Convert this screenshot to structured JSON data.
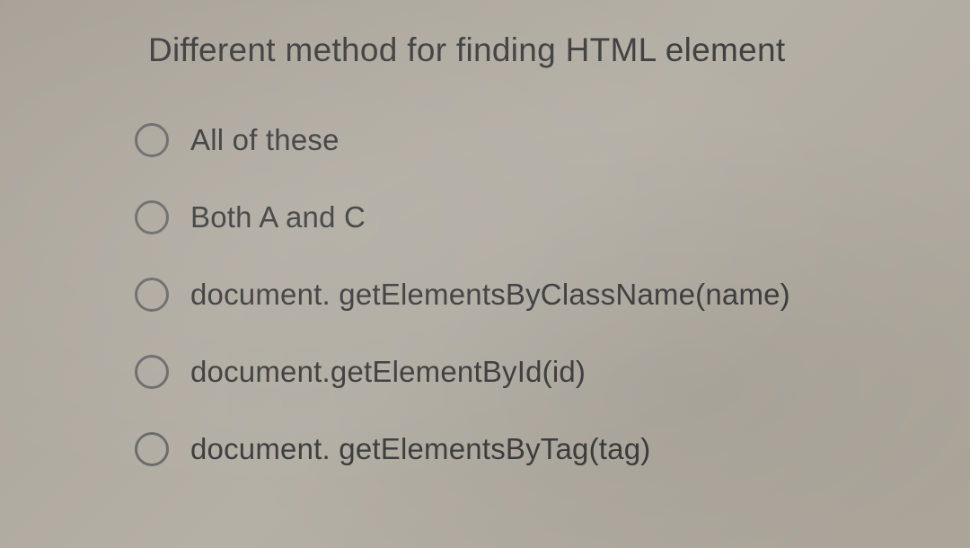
{
  "question": {
    "title": "Different method for finding HTML element",
    "options": [
      {
        "label": "All of these"
      },
      {
        "label": "Both A and C"
      },
      {
        "label": "document. getElementsByClassName(name)"
      },
      {
        "label": "document.getElementById(id)"
      },
      {
        "label": "document. getElementsByTag(tag)"
      }
    ]
  }
}
